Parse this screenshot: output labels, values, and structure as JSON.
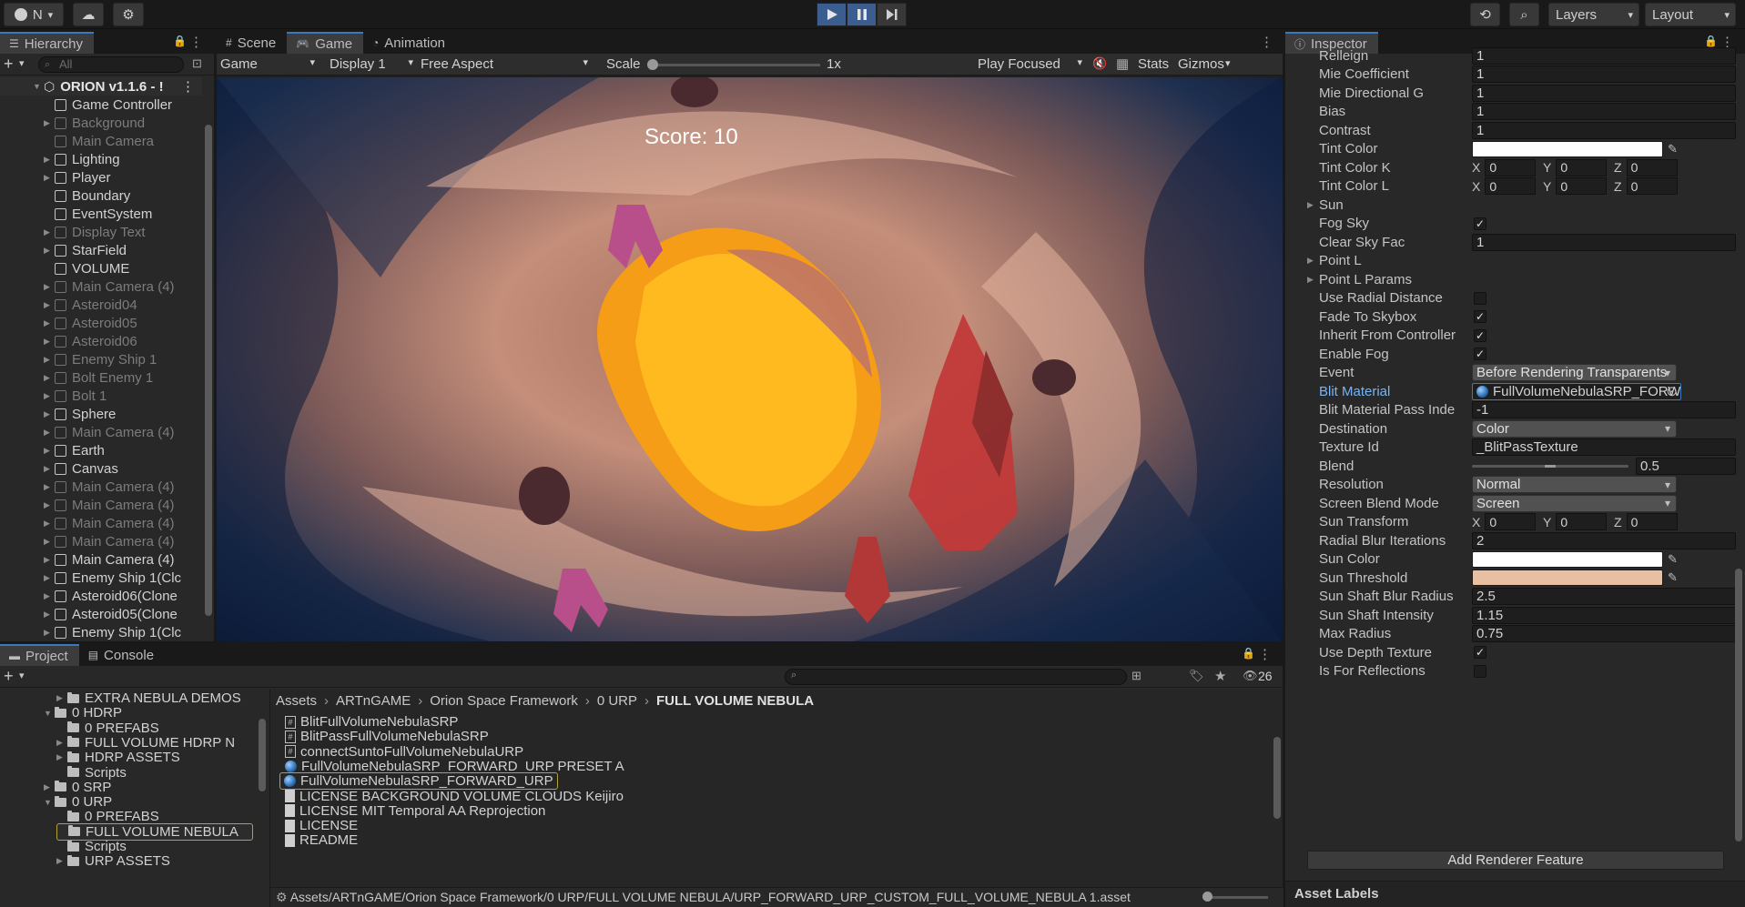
{
  "toolbar": {
    "account_label": "N",
    "layers_label": "Layers",
    "layout_label": "Layout"
  },
  "hierarchy": {
    "tab_label": "Hierarchy",
    "search_placeholder": "All",
    "root": "ORION v1.1.6 - !",
    "items": [
      {
        "label": "Game Controller",
        "dim": false,
        "fold": false
      },
      {
        "label": "Background",
        "dim": true,
        "fold": true
      },
      {
        "label": "Main Camera",
        "dim": true,
        "fold": false
      },
      {
        "label": "Lighting",
        "dim": false,
        "fold": true
      },
      {
        "label": "Player",
        "dim": false,
        "fold": true
      },
      {
        "label": "Boundary",
        "dim": false,
        "fold": false
      },
      {
        "label": "EventSystem",
        "dim": false,
        "fold": false
      },
      {
        "label": "Display Text",
        "dim": true,
        "fold": true
      },
      {
        "label": "StarField",
        "dim": false,
        "fold": true
      },
      {
        "label": "VOLUME",
        "dim": false,
        "fold": false
      },
      {
        "label": "Main Camera (4)",
        "dim": true,
        "fold": true
      },
      {
        "label": "Asteroid04",
        "dim": true,
        "fold": true
      },
      {
        "label": "Asteroid05",
        "dim": true,
        "fold": true
      },
      {
        "label": "Asteroid06",
        "dim": true,
        "fold": true
      },
      {
        "label": "Enemy Ship 1",
        "dim": true,
        "fold": true
      },
      {
        "label": "Bolt Enemy 1",
        "dim": true,
        "fold": true
      },
      {
        "label": "Bolt 1",
        "dim": true,
        "fold": true
      },
      {
        "label": "Sphere",
        "dim": false,
        "fold": true
      },
      {
        "label": "Main Camera (4)",
        "dim": true,
        "fold": true
      },
      {
        "label": "Earth",
        "dim": false,
        "fold": true
      },
      {
        "label": "Canvas",
        "dim": false,
        "fold": true
      },
      {
        "label": "Main Camera (4)",
        "dim": true,
        "fold": true
      },
      {
        "label": "Main Camera (4)",
        "dim": true,
        "fold": true
      },
      {
        "label": "Main Camera (4)",
        "dim": true,
        "fold": true
      },
      {
        "label": "Main Camera (4)",
        "dim": true,
        "fold": true
      },
      {
        "label": "Main Camera (4)",
        "dim": false,
        "fold": true
      },
      {
        "label": "Enemy Ship 1(Clc",
        "dim": false,
        "fold": true
      },
      {
        "label": "Asteroid06(Clone",
        "dim": false,
        "fold": true
      },
      {
        "label": "Asteroid05(Clone",
        "dim": false,
        "fold": true
      },
      {
        "label": "Enemy Ship 1(Clc",
        "dim": false,
        "fold": true
      }
    ]
  },
  "game": {
    "tabs": [
      "Scene",
      "Game",
      "Animation"
    ],
    "view_mode": "Game",
    "display": "Display 1",
    "aspect": "Free Aspect",
    "scale_label": "Scale",
    "scale_value": "1x",
    "play_mode": "Play Focused",
    "stats": "Stats",
    "gizmos": "Gizmos",
    "score_text": "Score: 10"
  },
  "inspector": {
    "tab_label": "Inspector",
    "rows": [
      {
        "type": "field",
        "label": "Relleign",
        "value": "1"
      },
      {
        "type": "field",
        "label": "Mie Coefficient",
        "value": "1"
      },
      {
        "type": "field",
        "label": "Mie Directional G",
        "value": "1"
      },
      {
        "type": "field",
        "label": "Bias",
        "value": "1"
      },
      {
        "type": "field",
        "label": "Contrast",
        "value": "1"
      },
      {
        "type": "color",
        "label": "Tint Color",
        "value": "#ffffff"
      },
      {
        "type": "xyz",
        "label": "Tint Color K",
        "x": "0",
        "y": "0",
        "z": "0"
      },
      {
        "type": "xyz",
        "label": "Tint Color L",
        "x": "0",
        "y": "0",
        "z": "0"
      },
      {
        "type": "fold",
        "label": "Sun"
      },
      {
        "type": "check",
        "label": "Fog Sky",
        "checked": true
      },
      {
        "type": "field",
        "label": "Clear Sky Fac",
        "value": "1"
      },
      {
        "type": "fold",
        "label": "Point L"
      },
      {
        "type": "fold",
        "label": "Point L Params"
      },
      {
        "type": "check",
        "label": "Use Radial Distance",
        "checked": false
      },
      {
        "type": "check",
        "label": "Fade To Skybox",
        "checked": true
      },
      {
        "type": "check",
        "label": "Inherit From Controller",
        "checked": true
      },
      {
        "type": "check",
        "label": "Enable Fog",
        "checked": true
      },
      {
        "type": "dropdown",
        "label": "Event",
        "value": "Before Rendering Transparents"
      },
      {
        "type": "object",
        "label": "Blit Material",
        "value": "FullVolumeNebulaSRP_FORWARD"
      },
      {
        "type": "field",
        "label": "Blit Material Pass Inde",
        "value": "-1"
      },
      {
        "type": "dropdown",
        "label": "Destination",
        "value": "Color"
      },
      {
        "type": "field",
        "label": "Texture Id",
        "value": "_BlitPassTexture"
      },
      {
        "type": "slider",
        "label": "Blend",
        "value": "0.5",
        "fraction": 0.5
      },
      {
        "type": "dropdown",
        "label": "Resolution",
        "value": "Normal"
      },
      {
        "type": "dropdown",
        "label": "Screen Blend Mode",
        "value": "Screen"
      },
      {
        "type": "xyz",
        "label": "Sun Transform",
        "x": "0",
        "y": "0",
        "z": "0"
      },
      {
        "type": "field",
        "label": "Radial Blur Iterations",
        "value": "2"
      },
      {
        "type": "color",
        "label": "Sun Color",
        "value": "#ffffff"
      },
      {
        "type": "color",
        "label": "Sun Threshold",
        "value": "#e8bfa3"
      },
      {
        "type": "field",
        "label": "Sun Shaft Blur Radius",
        "value": "2.5"
      },
      {
        "type": "field",
        "label": "Sun Shaft Intensity",
        "value": "1.15"
      },
      {
        "type": "field",
        "label": "Max Radius",
        "value": "0.75"
      },
      {
        "type": "check",
        "label": "Use Depth Texture",
        "checked": true
      },
      {
        "type": "check",
        "label": "Is For Reflections",
        "checked": false
      }
    ],
    "add_button": "Add Renderer Feature",
    "asset_labels": "Asset Labels"
  },
  "project": {
    "tabs": [
      "Project",
      "Console"
    ],
    "hidden_count": "26",
    "tree": [
      {
        "label": "EXTRA NEBULA DEMOS",
        "indent": 1,
        "open": false
      },
      {
        "label": "0 HDRP",
        "indent": 0,
        "open": true
      },
      {
        "label": "0 PREFABS",
        "indent": 1,
        "open": null
      },
      {
        "label": "FULL VOLUME HDRP N",
        "indent": 1,
        "open": false
      },
      {
        "label": "HDRP ASSETS",
        "indent": 1,
        "open": false
      },
      {
        "label": "Scripts",
        "indent": 1,
        "open": null
      },
      {
        "label": "0 SRP",
        "indent": 0,
        "open": false
      },
      {
        "label": "0 URP",
        "indent": 0,
        "open": true
      },
      {
        "label": "0 PREFABS",
        "indent": 1,
        "open": null
      },
      {
        "label": "FULL VOLUME NEBULA",
        "indent": 1,
        "open": null,
        "selected": true
      },
      {
        "label": "Scripts",
        "indent": 1,
        "open": null
      },
      {
        "label": "URP ASSETS",
        "indent": 1,
        "open": false
      }
    ],
    "breadcrumb": [
      "Assets",
      "ARTnGAME",
      "Orion Space Framework",
      "0 URP",
      "FULL VOLUME NEBULA"
    ],
    "files": [
      {
        "label": "BlitFullVolumeNebulaSRP",
        "icon": "script"
      },
      {
        "label": "BlitPassFullVolumeNebulaSRP",
        "icon": "script"
      },
      {
        "label": "connectSuntoFullVolumeNebulaURP",
        "icon": "script"
      },
      {
        "label": "FullVolumeNebulaSRP_FORWARD_URP PRESET A",
        "icon": "material"
      },
      {
        "label": "FullVolumeNebulaSRP_FORWARD_URP",
        "icon": "material",
        "selected": true
      },
      {
        "label": "LICENSE BACKGROUND VOLUME CLOUDS Keijiro",
        "icon": "doc"
      },
      {
        "label": "LICENSE MIT Temporal AA Reprojection",
        "icon": "doc"
      },
      {
        "label": "LICENSE",
        "icon": "doc"
      },
      {
        "label": "README",
        "icon": "doc"
      }
    ],
    "status_path": "Assets/ARTnGAME/Orion Space Framework/0 URP/FULL VOLUME NEBULA/URP_FORWARD_URP_CUSTOM_FULL_VOLUME_NEBULA 1.asset"
  }
}
